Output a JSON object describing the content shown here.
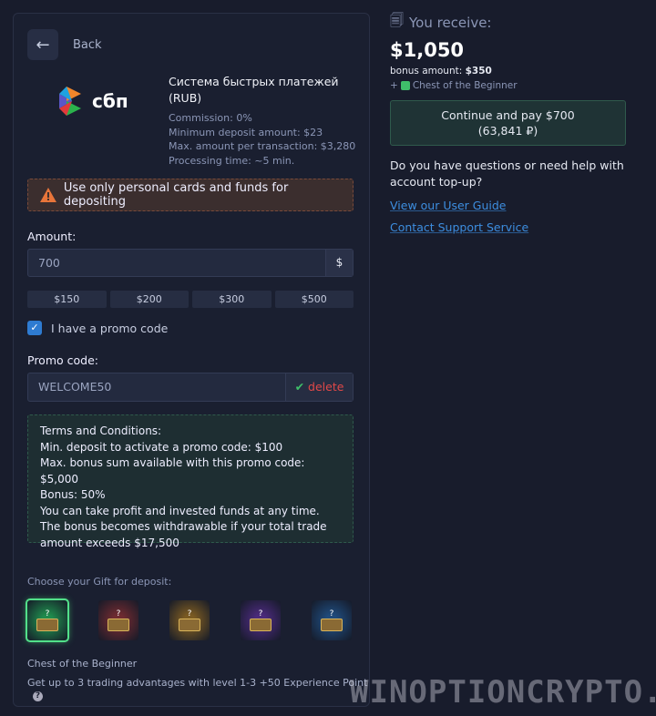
{
  "back": {
    "label": "Back"
  },
  "method": {
    "logo_text": "сбп",
    "title": "Система быстрых платежей (RUB)",
    "details": [
      "Commission: 0%",
      "Minimum deposit amount: $23",
      "Max. amount per transaction: $3,280",
      "Processing time: ~5 min."
    ]
  },
  "warning": "Use only personal cards and funds for depositing",
  "amount": {
    "label": "Amount:",
    "value": "700",
    "currency": "$",
    "quick": [
      "$150",
      "$200",
      "$300",
      "$500"
    ]
  },
  "promo_checkbox": {
    "label": "I have a promo code",
    "checked": true
  },
  "promo": {
    "label": "Promo code:",
    "value": "WELCOME50",
    "delete_label": "delete"
  },
  "terms": [
    "Terms and Conditions:",
    "Min. deposit to activate a promo code: $100",
    "Max. bonus sum available with this promo code: $5,000",
    "Bonus: 50%",
    "You can take profit and invested funds at any time.",
    "The bonus becomes withdrawable if your total trade amount exceeds $17,500"
  ],
  "gift": {
    "title": "Choose your Gift for deposit:",
    "chests": [
      {
        "color": "#1f8a4c",
        "selected": true
      },
      {
        "color": "#6e2a30"
      },
      {
        "color": "#7a5a22"
      },
      {
        "color": "#4a2a7a"
      },
      {
        "color": "#1f4a7a"
      }
    ],
    "name": "Chest of the Beginner",
    "desc": "Get up to 3 trading advantages with level 1-3 +50 Experience Point"
  },
  "summary": {
    "receive_label": "You receive:",
    "total": "$1,050",
    "bonus_label": "bonus amount:",
    "bonus_value": "$350",
    "chest": "Chest of the Beginner",
    "pay_line1": "Continue and pay $700",
    "pay_line2": "(63,841 ₽)",
    "question": "Do you have questions or need help with account top-up?",
    "link_guide": "View our User Guide",
    "link_support": "Contact Support Service"
  },
  "watermark": "WINOPTIONCRYPTO.COM"
}
